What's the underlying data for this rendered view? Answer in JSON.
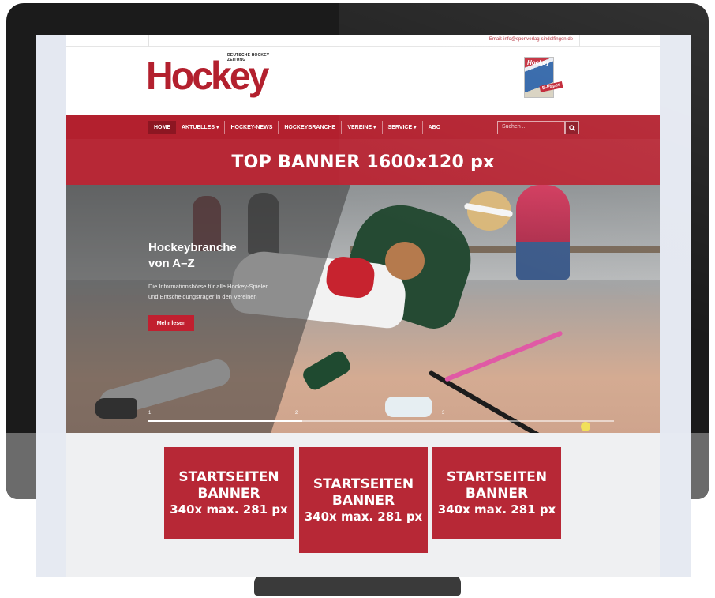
{
  "site": {
    "topbar_email": "Email: info@sportverlag-sindelfingen.de",
    "logo_tagline": "DEUTSCHE HOCKEY ZEITUNG",
    "logo_word": "Hockey",
    "epaper_cover_title": "Hockey",
    "epaper_tag": "E-Paper"
  },
  "nav": {
    "items": [
      {
        "label": "HOME"
      },
      {
        "label": "AKTUELLES ▾"
      },
      {
        "label": "HOCKEY-NEWS"
      },
      {
        "label": "HOCKEYBRANCHE"
      },
      {
        "label": "VEREINE ▾"
      },
      {
        "label": "SERVICE ▾"
      },
      {
        "label": "ABO"
      }
    ],
    "search_placeholder": "Suchen ...",
    "search_icon": "search-icon"
  },
  "top_banner": {
    "text": "TOP BANNER 1600x120 px"
  },
  "hero": {
    "title_line1": "Hockeybranche",
    "title_line2": "von A–Z",
    "desc_line1": "Die Informationsbörse für alle Hockey-Spieler",
    "desc_line2": "und Entscheidungsträger in den Vereinen",
    "button_label": "Mehr lesen",
    "slide_numbers": [
      "1",
      "2",
      "3"
    ],
    "progress_fraction": 0.33
  },
  "startseiten_banners": [
    {
      "line1": "STARTSEITEN",
      "line2": "BANNER",
      "line3": "340x max. 281 px"
    },
    {
      "line1": "STARTSEITEN",
      "line2": "BANNER",
      "line3": "340x max. 281 px"
    },
    {
      "line1": "STARTSEITEN",
      "line2": "BANNER",
      "line3": "340x max. 281 px"
    }
  ],
  "colors": {
    "brand_red": "#b3202e",
    "banner_red": "#b72836",
    "nav_active": "#8c1622"
  }
}
